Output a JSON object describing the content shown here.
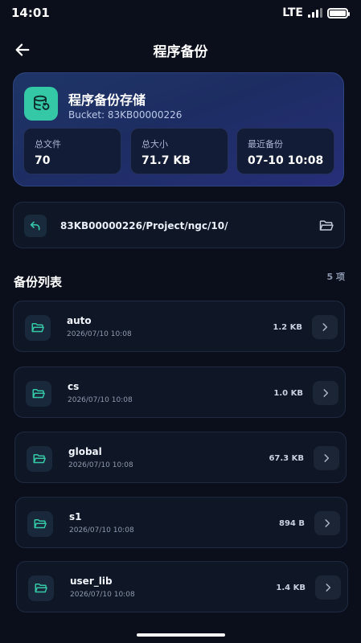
{
  "status_bar": {
    "time": "14:01",
    "network": "LTE",
    "signal_icon": "signal-bars-icon",
    "battery_icon": "battery-icon"
  },
  "header": {
    "back_icon": "arrow-left-icon",
    "title": "程序备份"
  },
  "summary": {
    "icon": "database-backup-icon",
    "title": "程序备份存储",
    "bucket": "Bucket: 83KB00000226",
    "stats": [
      {
        "label": "总文件",
        "value": "70"
      },
      {
        "label": "总大小",
        "value": "71.7 KB"
      },
      {
        "label": "最近备份",
        "value": "07-10 10:08"
      }
    ]
  },
  "path": {
    "up_icon": "return-up-icon",
    "text": "83KB00000226/Project/ngc/10/",
    "folder_icon": "folder-open-icon"
  },
  "list": {
    "title": "备份列表",
    "count": "5 项",
    "items": [
      {
        "name": "auto",
        "date": "2026/07/10 10:08",
        "size": "1.2 KB"
      },
      {
        "name": "cs",
        "date": "2026/07/10 10:08",
        "size": "1.0 KB"
      },
      {
        "name": "global",
        "date": "2026/07/10 10:08",
        "size": "67.3 KB"
      },
      {
        "name": "s1",
        "date": "2026/07/10 10:08",
        "size": "894 B"
      },
      {
        "name": "user_lib",
        "date": "2026/07/10 10:08",
        "size": "1.4 KB"
      }
    ]
  },
  "colors": {
    "background": "#0a0f1b",
    "accent_teal": "#35c8a6",
    "card_blue": "#1f3566",
    "item_bg": "#0f1727"
  }
}
